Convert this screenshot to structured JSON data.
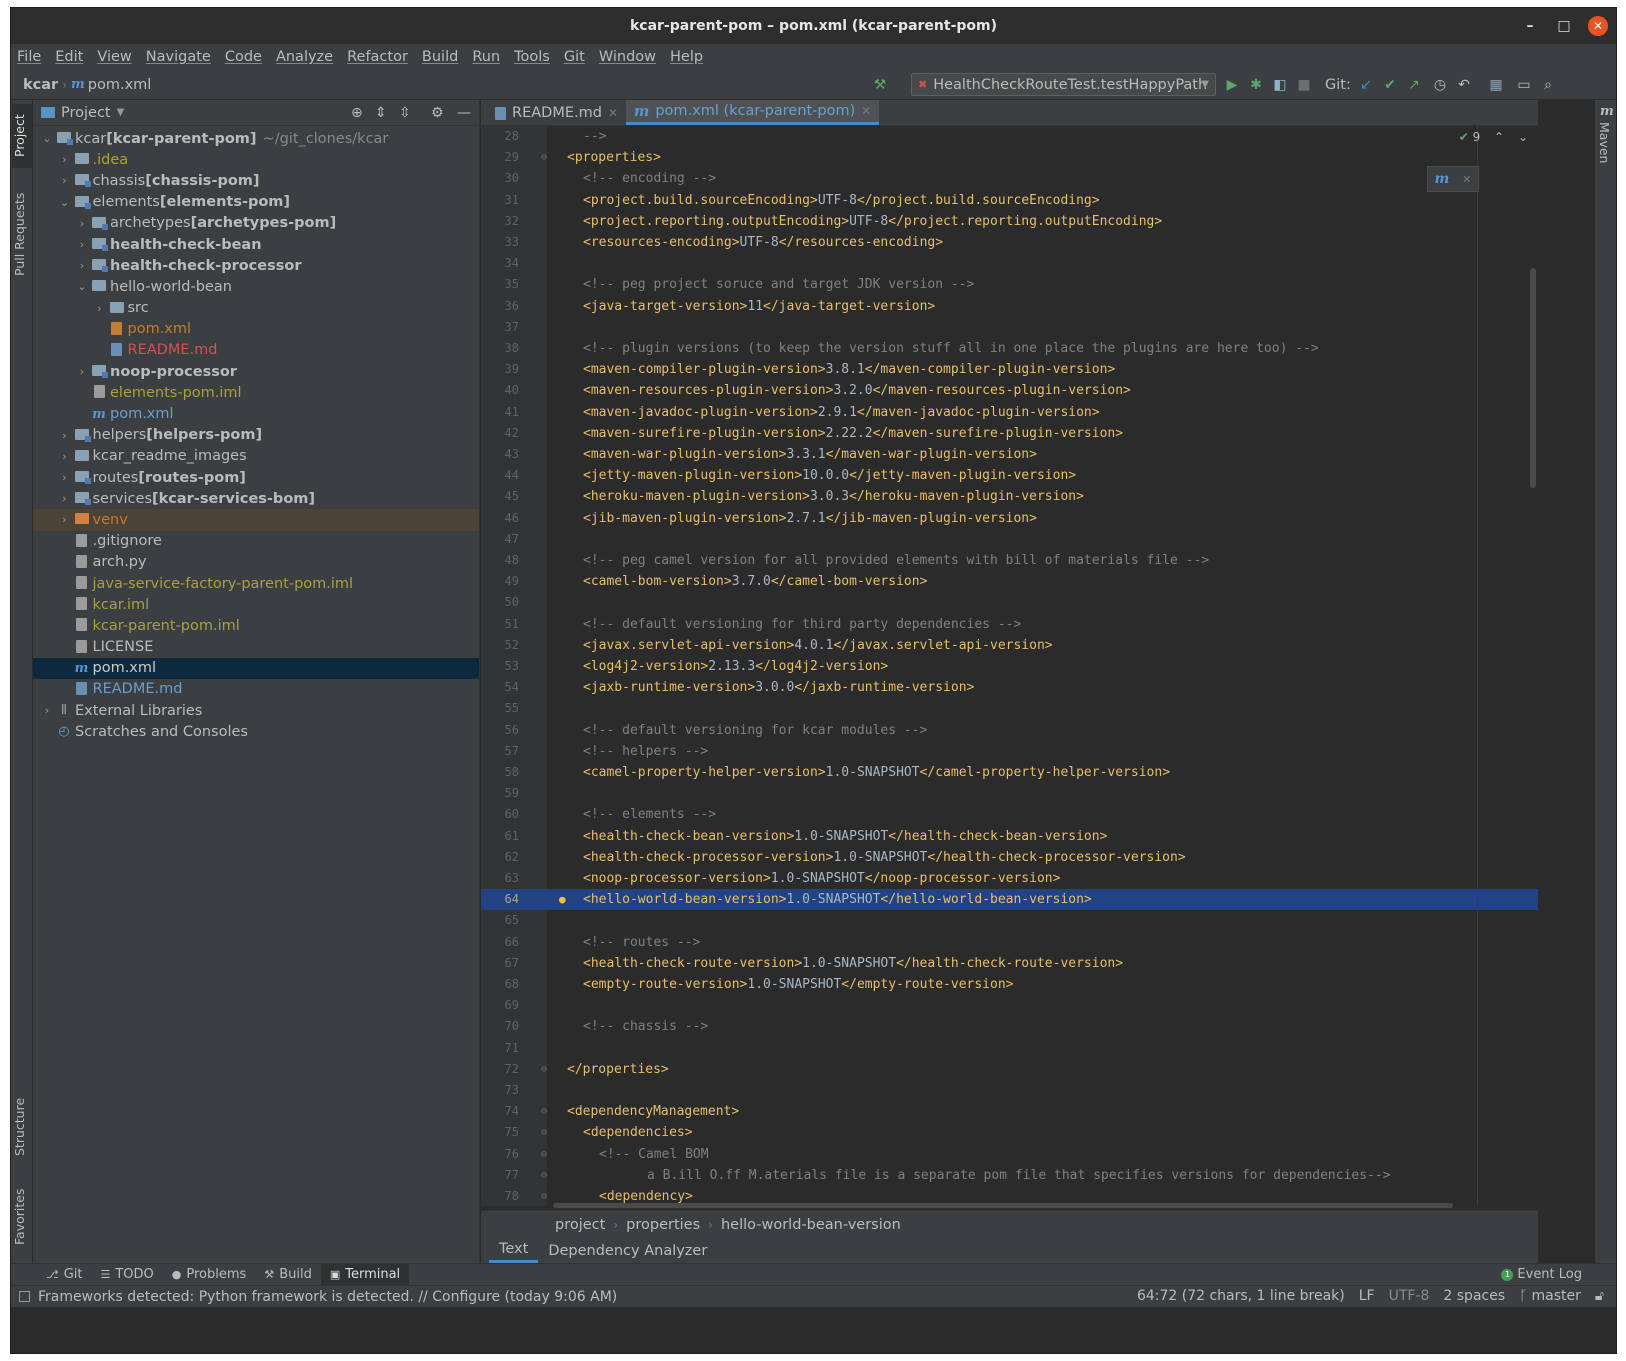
{
  "window": {
    "title": "kcar-parent-pom – pom.xml (kcar-parent-pom)",
    "minimize": "–",
    "maximize": "□",
    "close": "✕"
  },
  "menu": [
    "File",
    "Edit",
    "View",
    "Navigate",
    "Code",
    "Analyze",
    "Refactor",
    "Build",
    "Run",
    "Tools",
    "Git",
    "Window",
    "Help"
  ],
  "navbar": {
    "root": "kcar",
    "file": "pom.xml",
    "run_config": "HealthCheckRouteTest.testHappyPath",
    "git_label": "Git:"
  },
  "left_strip": {
    "project": "Project",
    "pull_requests": "Pull Requests",
    "structure": "Structure",
    "favorites": "Favorites"
  },
  "project_panel": {
    "title": "Project"
  },
  "tree": [
    {
      "depth": 0,
      "arrow": "⌄",
      "icon": "module",
      "label": "kcar",
      "bold": " [kcar-parent-pom]",
      "dim": "~/git_clones/kcar",
      "style": "lbl-normal"
    },
    {
      "depth": 1,
      "arrow": "›",
      "icon": "folder",
      "label": ".idea",
      "style": "lbl-yellow"
    },
    {
      "depth": 1,
      "arrow": "›",
      "icon": "module",
      "label": "chassis",
      "bold": " [chassis-pom]",
      "style": "lbl-normal"
    },
    {
      "depth": 1,
      "arrow": "⌄",
      "icon": "module",
      "label": "elements",
      "bold": " [elements-pom]",
      "style": "lbl-normal"
    },
    {
      "depth": 2,
      "arrow": "›",
      "icon": "module",
      "label": "archetypes",
      "bold": " [archetypes-pom]",
      "style": "lbl-normal"
    },
    {
      "depth": 2,
      "arrow": "›",
      "icon": "module",
      "label": "",
      "bold": "health-check-bean",
      "style": "lbl-normal"
    },
    {
      "depth": 2,
      "arrow": "›",
      "icon": "module",
      "label": "",
      "bold": "health-check-processor",
      "style": "lbl-normal"
    },
    {
      "depth": 2,
      "arrow": "⌄",
      "icon": "folder",
      "label": "hello-world-bean",
      "style": "lbl-normal"
    },
    {
      "depth": 3,
      "arrow": "›",
      "icon": "folder",
      "label": "src",
      "style": "lbl-normal"
    },
    {
      "depth": 3,
      "arrow": "",
      "icon": "maven-file",
      "label": "pom.xml",
      "style": "lbl-orange"
    },
    {
      "depth": 3,
      "arrow": "",
      "icon": "md-file",
      "label": "README.md",
      "style": "lbl-red"
    },
    {
      "depth": 2,
      "arrow": "›",
      "icon": "module",
      "label": "",
      "bold": "noop-processor",
      "style": "lbl-normal"
    },
    {
      "depth": 2,
      "arrow": "",
      "icon": "file",
      "label": "elements-pom.iml",
      "style": "lbl-olive"
    },
    {
      "depth": 2,
      "arrow": "",
      "icon": "m",
      "label": "pom.xml",
      "style": "lbl-blue"
    },
    {
      "depth": 1,
      "arrow": "›",
      "icon": "module",
      "label": "helpers",
      "bold": " [helpers-pom]",
      "style": "lbl-normal"
    },
    {
      "depth": 1,
      "arrow": "›",
      "icon": "folder",
      "label": "kcar_readme_images",
      "style": "lbl-normal"
    },
    {
      "depth": 1,
      "arrow": "›",
      "icon": "module",
      "label": "routes",
      "bold": " [routes-pom]",
      "style": "lbl-normal"
    },
    {
      "depth": 1,
      "arrow": "›",
      "icon": "module",
      "label": "services",
      "bold": " [kcar-services-bom]",
      "style": "lbl-normal"
    },
    {
      "depth": 1,
      "arrow": "›",
      "icon": "folder-orange",
      "label": "venv",
      "style": "lbl-orange",
      "excluded": true
    },
    {
      "depth": 1,
      "arrow": "",
      "icon": "file",
      "label": ".gitignore",
      "style": "lbl-normal"
    },
    {
      "depth": 1,
      "arrow": "",
      "icon": "file",
      "label": "arch.py",
      "style": "lbl-normal"
    },
    {
      "depth": 1,
      "arrow": "",
      "icon": "file",
      "label": "java-service-factory-parent-pom.iml",
      "style": "lbl-olive"
    },
    {
      "depth": 1,
      "arrow": "",
      "icon": "file",
      "label": "kcar.iml",
      "style": "lbl-olive"
    },
    {
      "depth": 1,
      "arrow": "",
      "icon": "file",
      "label": "kcar-parent-pom.iml",
      "style": "lbl-olive"
    },
    {
      "depth": 1,
      "arrow": "",
      "icon": "file",
      "label": "LICENSE",
      "style": "lbl-normal"
    },
    {
      "depth": 1,
      "arrow": "",
      "icon": "m",
      "label": "pom.xml",
      "style": "lbl-white",
      "selected": true
    },
    {
      "depth": 1,
      "arrow": "",
      "icon": "md-file",
      "label": "README.md",
      "style": "lbl-blue"
    },
    {
      "depth": 0,
      "arrow": "›",
      "icon": "libs",
      "label": "External Libraries",
      "style": "lbl-normal"
    },
    {
      "depth": 0,
      "arrow": "",
      "icon": "scratch",
      "label": "Scratches and Consoles",
      "style": "lbl-normal"
    }
  ],
  "tabs": [
    {
      "label": "README.md",
      "icon": "md",
      "active": false
    },
    {
      "label": "pom.xml (kcar-parent-pom)",
      "icon": "m",
      "active": true
    }
  ],
  "inspection": "9",
  "code": [
    {
      "n": "28",
      "i": 1,
      "t": "-->",
      "k": "comment"
    },
    {
      "n": "29",
      "i": 0,
      "t": "<properties>",
      "k": "tag",
      "f": true
    },
    {
      "n": "30",
      "i": 1,
      "t": "<!-- encoding -->",
      "k": "comment"
    },
    {
      "n": "31",
      "i": 1,
      "t": "<project.build.sourceEncoding>UTF-8</project.build.sourceEncoding>",
      "k": "elem"
    },
    {
      "n": "32",
      "i": 1,
      "t": "<project.reporting.outputEncoding>UTF-8</project.reporting.outputEncoding>",
      "k": "elem"
    },
    {
      "n": "33",
      "i": 1,
      "t": "<resources-encoding>UTF-8</resources-encoding>",
      "k": "elem"
    },
    {
      "n": "34",
      "i": 0,
      "t": "",
      "k": "blank"
    },
    {
      "n": "35",
      "i": 1,
      "t": "<!-- peg project soruce and target JDK version -->",
      "k": "comment"
    },
    {
      "n": "36",
      "i": 1,
      "t": "<java-target-version>11</java-target-version>",
      "k": "elem"
    },
    {
      "n": "37",
      "i": 0,
      "t": "",
      "k": "blank"
    },
    {
      "n": "38",
      "i": 1,
      "t": "<!-- plugin versions (to keep the version stuff all in one place the plugins are here too) -->",
      "k": "comment"
    },
    {
      "n": "39",
      "i": 1,
      "t": "<maven-compiler-plugin-version>3.8.1</maven-compiler-plugin-version>",
      "k": "elem"
    },
    {
      "n": "40",
      "i": 1,
      "t": "<maven-resources-plugin-version>3.2.0</maven-resources-plugin-version>",
      "k": "elem"
    },
    {
      "n": "41",
      "i": 1,
      "t": "<maven-javadoc-plugin-version>2.9.1</maven-javadoc-plugin-version>",
      "k": "elem"
    },
    {
      "n": "42",
      "i": 1,
      "t": "<maven-surefire-plugin-version>2.22.2</maven-surefire-plugin-version>",
      "k": "elem"
    },
    {
      "n": "43",
      "i": 1,
      "t": "<maven-war-plugin-version>3.3.1</maven-war-plugin-version>",
      "k": "elem"
    },
    {
      "n": "44",
      "i": 1,
      "t": "<jetty-maven-plugin-version>10.0.0</jetty-maven-plugin-version>",
      "k": "elem"
    },
    {
      "n": "45",
      "i": 1,
      "t": "<heroku-maven-plugin-version>3.0.3</heroku-maven-plugin-version>",
      "k": "elem"
    },
    {
      "n": "46",
      "i": 1,
      "t": "<jib-maven-plugin-version>2.7.1</jib-maven-plugin-version>",
      "k": "elem"
    },
    {
      "n": "47",
      "i": 0,
      "t": "",
      "k": "blank"
    },
    {
      "n": "48",
      "i": 1,
      "t": "<!-- peg camel version for all provided elements with bill of materials file -->",
      "k": "comment"
    },
    {
      "n": "49",
      "i": 1,
      "t": "<camel-bom-version>3.7.0</camel-bom-version>",
      "k": "elem"
    },
    {
      "n": "50",
      "i": 0,
      "t": "",
      "k": "blank"
    },
    {
      "n": "51",
      "i": 1,
      "t": "<!-- default versioning for third party dependencies -->",
      "k": "comment"
    },
    {
      "n": "52",
      "i": 1,
      "t": "<javax.servlet-api-version>4.0.1</javax.servlet-api-version>",
      "k": "elem"
    },
    {
      "n": "53",
      "i": 1,
      "t": "<log4j2-version>2.13.3</log4j2-version>",
      "k": "elem"
    },
    {
      "n": "54",
      "i": 1,
      "t": "<jaxb-runtime-version>3.0.0</jaxb-runtime-version>",
      "k": "elem"
    },
    {
      "n": "55",
      "i": 0,
      "t": "",
      "k": "blank"
    },
    {
      "n": "56",
      "i": 1,
      "t": "<!-- default versioning for kcar modules -->",
      "k": "comment"
    },
    {
      "n": "57",
      "i": 1,
      "t": "<!-- helpers -->",
      "k": "comment"
    },
    {
      "n": "58",
      "i": 1,
      "t": "<camel-property-helper-version>1.0-SNAPSHOT</camel-property-helper-version>",
      "k": "elem"
    },
    {
      "n": "59",
      "i": 0,
      "t": "",
      "k": "blank"
    },
    {
      "n": "60",
      "i": 1,
      "t": "<!-- elements -->",
      "k": "comment"
    },
    {
      "n": "61",
      "i": 1,
      "t": "<health-check-bean-version>1.0-SNAPSHOT</health-check-bean-version>",
      "k": "elem"
    },
    {
      "n": "62",
      "i": 1,
      "t": "<health-check-processor-version>1.0-SNAPSHOT</health-check-processor-version>",
      "k": "elem"
    },
    {
      "n": "63",
      "i": 1,
      "t": "<noop-processor-version>1.0-SNAPSHOT</noop-processor-version>",
      "k": "elem"
    },
    {
      "n": "64",
      "i": 1,
      "t": "<hello-world-bean-version>1.0-SNAPSHOT</hello-world-bean-version>",
      "k": "elem",
      "current": true
    },
    {
      "n": "65",
      "i": 0,
      "t": "",
      "k": "blank"
    },
    {
      "n": "66",
      "i": 1,
      "t": "<!-- routes -->",
      "k": "comment"
    },
    {
      "n": "67",
      "i": 1,
      "t": "<health-check-route-version>1.0-SNAPSHOT</health-check-route-version>",
      "k": "elem"
    },
    {
      "n": "68",
      "i": 1,
      "t": "<empty-route-version>1.0-SNAPSHOT</empty-route-version>",
      "k": "elem"
    },
    {
      "n": "69",
      "i": 0,
      "t": "",
      "k": "blank"
    },
    {
      "n": "70",
      "i": 1,
      "t": "<!-- chassis -->",
      "k": "comment"
    },
    {
      "n": "71",
      "i": 0,
      "t": "",
      "k": "blank"
    },
    {
      "n": "72",
      "i": 0,
      "t": "</properties>",
      "k": "tag",
      "f": true
    },
    {
      "n": "73",
      "i": 0,
      "t": "",
      "k": "blank"
    },
    {
      "n": "74",
      "i": 0,
      "t": "<dependencyManagement>",
      "k": "tag",
      "f": true
    },
    {
      "n": "75",
      "i": 1,
      "t": "<dependencies>",
      "k": "tag",
      "f": true
    },
    {
      "n": "76",
      "i": 2,
      "t": "<!-- Camel BOM",
      "k": "comment",
      "f": true
    },
    {
      "n": "77",
      "i": 5,
      "t": "a B.ill O.ff M.aterials file is a separate pom file that specifies versions for dependencies-->",
      "k": "comment",
      "f": true
    },
    {
      "n": "78",
      "i": 2,
      "t": "<dependency>",
      "k": "tag",
      "f": true
    }
  ],
  "breadcrumbs": [
    "project",
    "properties",
    "hello-world-bean-version"
  ],
  "bottom_tabs": [
    "Text",
    "Dependency Analyzer"
  ],
  "right_strip": {
    "maven": "Maven"
  },
  "tool_windows": [
    {
      "label": "Git",
      "icon": "⎇"
    },
    {
      "label": "TODO",
      "icon": "☰"
    },
    {
      "label": "Problems",
      "icon": "●"
    },
    {
      "label": "Build",
      "icon": "⚒"
    },
    {
      "label": "Terminal",
      "icon": "▣",
      "active": true
    }
  ],
  "event_log": "Event Log",
  "status": {
    "message": "Frameworks detected: Python framework is detected. // Configure (today 9:06 AM)",
    "position": "64:72 (72 chars, 1 line break)",
    "line_sep": "LF",
    "encoding": "UTF-8",
    "indent": "2 spaces",
    "branch": "master"
  }
}
